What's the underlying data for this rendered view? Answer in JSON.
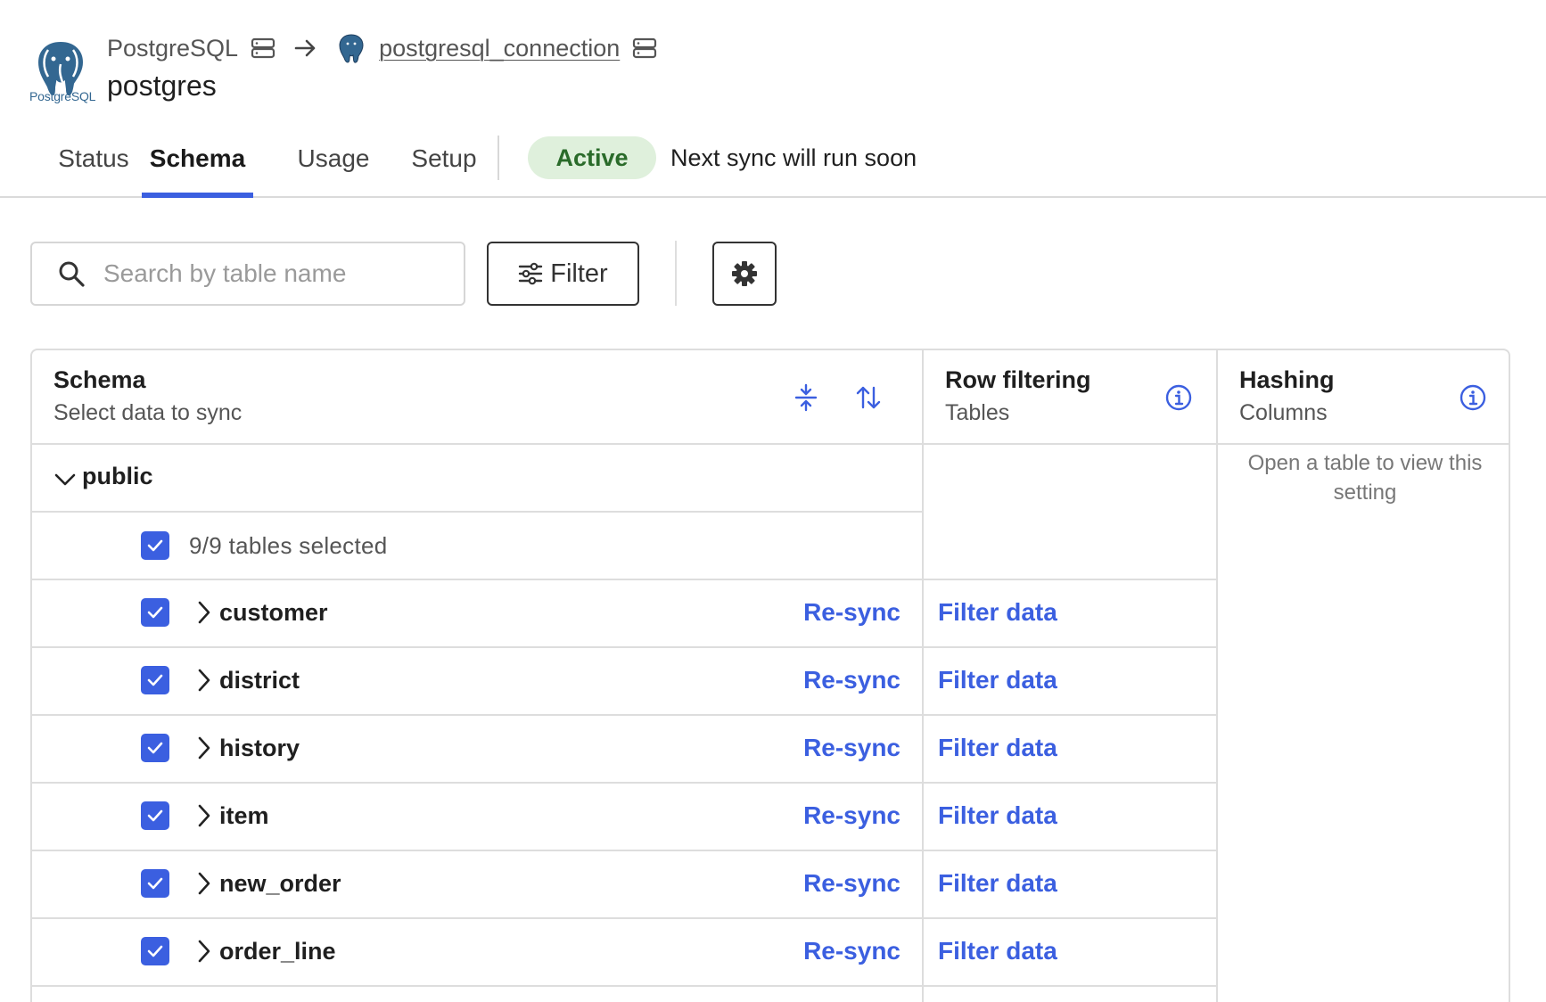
{
  "header": {
    "source_label": "PostgreSQL",
    "logo_text": "PostgreSQL",
    "connection_link": "postgresql_connection",
    "database_name": "postgres"
  },
  "tabs": [
    {
      "label": "Status"
    },
    {
      "label": "Schema",
      "active": true
    },
    {
      "label": "Usage"
    },
    {
      "label": "Setup"
    }
  ],
  "status": {
    "badge": "Active",
    "message": "Next sync will run soon"
  },
  "toolbar": {
    "search_placeholder": "Search by table name",
    "filter_label": "Filter"
  },
  "table": {
    "columns": [
      {
        "title": "Schema",
        "subtitle": "Select data to sync"
      },
      {
        "title": "Row filtering",
        "subtitle": "Tables"
      },
      {
        "title": "Hashing",
        "subtitle": "Columns"
      }
    ],
    "hashing_note": "Open a table to view this setting",
    "group": {
      "name": "public",
      "selection_summary": "9/9 tables selected"
    },
    "rows": [
      {
        "name": "customer",
        "action": "Re-sync",
        "filter": "Filter data",
        "checked": true
      },
      {
        "name": "district",
        "action": "Re-sync",
        "filter": "Filter data",
        "checked": true
      },
      {
        "name": "history",
        "action": "Re-sync",
        "filter": "Filter data",
        "checked": true
      },
      {
        "name": "item",
        "action": "Re-sync",
        "filter": "Filter data",
        "checked": true
      },
      {
        "name": "new_order",
        "action": "Re-sync",
        "filter": "Filter data",
        "checked": true
      },
      {
        "name": "order_line",
        "action": "Re-sync",
        "filter": "Filter data",
        "checked": true
      }
    ]
  },
  "colors": {
    "accent": "#3b5fe0",
    "active_badge_bg": "#dff0dc",
    "active_badge_text": "#2a6b2a",
    "border": "#dddddd"
  },
  "icons": [
    "postgresql-logo-icon",
    "server-icon",
    "arrow-right-icon",
    "search-icon",
    "filter-icon",
    "gear-icon",
    "collapse-icon",
    "sort-icon",
    "info-icon",
    "chevron-down-icon",
    "chevron-right-icon",
    "check-icon"
  ]
}
